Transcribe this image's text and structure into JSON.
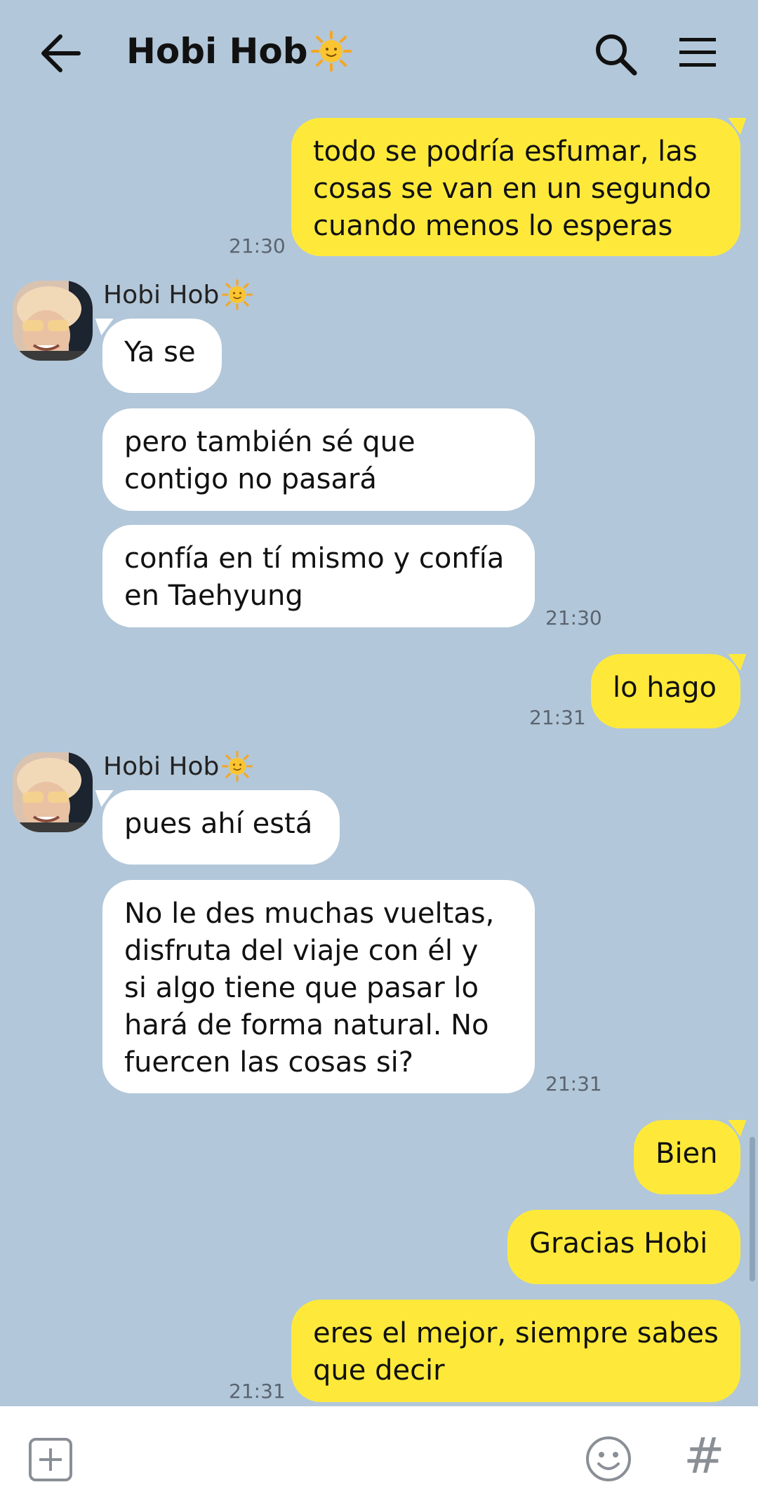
{
  "header": {
    "title": "Hobi Hob",
    "title_emoji_icon": "sun-face-icon"
  },
  "messages": [
    {
      "from": "me",
      "text": "todo se podría esfumar, las\ncosas se van en un segundo\ncuando menos lo esperas",
      "time": "21:30"
    },
    {
      "from": "them",
      "sender": "Hobi Hob",
      "text": "Ya se"
    },
    {
      "from": "them",
      "text": "pero también sé que\ncontigo no pasará"
    },
    {
      "from": "them",
      "text": "confía en tí mismo y confía\nen Taehyung",
      "time": "21:30"
    },
    {
      "from": "me",
      "text": "lo hago",
      "time": "21:31"
    },
    {
      "from": "them",
      "sender": "Hobi Hob",
      "text": "pues ahí está"
    },
    {
      "from": "them",
      "text": "No le des muchas vueltas,\ndisfruta del viaje con él y\nsi algo tiene que pasar lo\nhará de forma natural. No\nfuercen las cosas si?",
      "time": "21:31"
    },
    {
      "from": "me",
      "text": "Bien"
    },
    {
      "from": "me",
      "text": "Gracias Hobi"
    },
    {
      "from": "me",
      "text": "eres el mejor, siempre sabes\nque decir",
      "time": "21:31"
    }
  ],
  "input_bar": {
    "attach_icon": "plus-square-icon",
    "emoji_icon": "smiley-icon",
    "hashtag_icon": "#"
  },
  "colors": {
    "background": "#b2c7d9",
    "my_bubble": "#fee93b",
    "their_bubble": "#ffffff"
  }
}
